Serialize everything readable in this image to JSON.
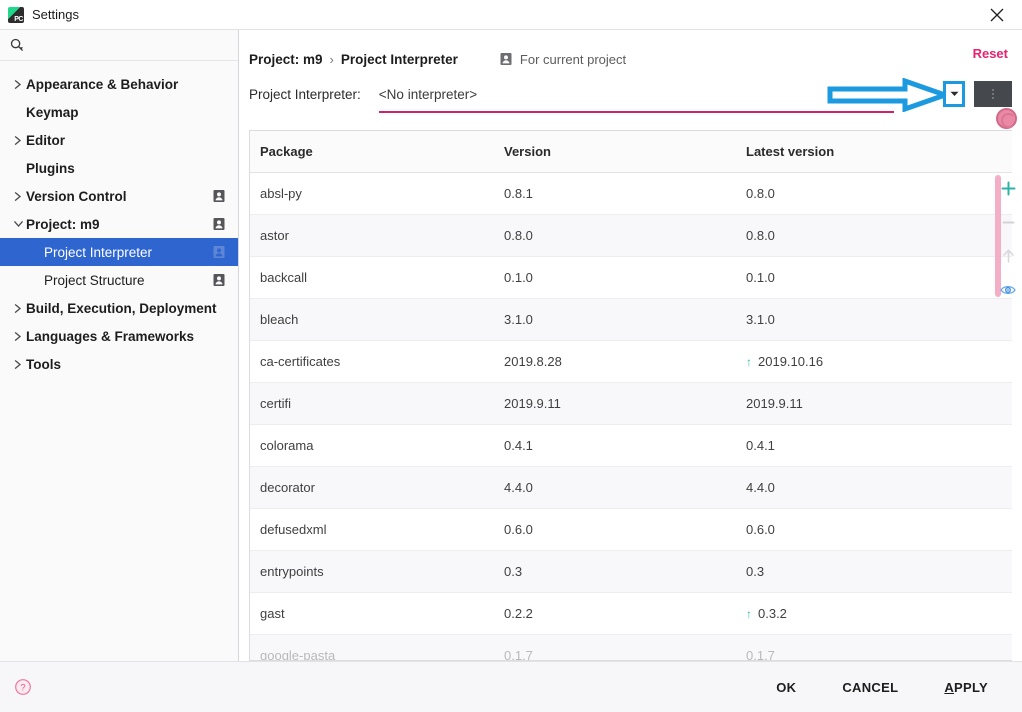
{
  "window": {
    "title": "Settings",
    "logo_icon": "pycharm-logo-icon",
    "close_icon": "close-icon"
  },
  "sidebar": {
    "search": {
      "placeholder": "",
      "value": "",
      "icon": "search-icon"
    },
    "items": [
      {
        "label": "Appearance & Behavior",
        "chevron": "chevron-right",
        "level": 0,
        "bold": true,
        "badge": false,
        "selected": false
      },
      {
        "label": "Keymap",
        "chevron": "",
        "level": 0,
        "bold": true,
        "badge": false,
        "selected": false
      },
      {
        "label": "Editor",
        "chevron": "chevron-right",
        "level": 0,
        "bold": true,
        "badge": false,
        "selected": false
      },
      {
        "label": "Plugins",
        "chevron": "",
        "level": 0,
        "bold": true,
        "badge": false,
        "selected": false
      },
      {
        "label": "Version Control",
        "chevron": "chevron-right",
        "level": 0,
        "bold": true,
        "badge": true,
        "selected": false
      },
      {
        "label": "Project: m9",
        "chevron": "chevron-down",
        "level": 0,
        "bold": true,
        "badge": true,
        "selected": false
      },
      {
        "label": "Project Interpreter",
        "chevron": "",
        "level": 1,
        "bold": false,
        "badge": true,
        "selected": true
      },
      {
        "label": "Project Structure",
        "chevron": "",
        "level": 1,
        "bold": false,
        "badge": true,
        "selected": false
      },
      {
        "label": "Build, Execution, Deployment",
        "chevron": "chevron-right",
        "level": 0,
        "bold": true,
        "badge": false,
        "selected": false
      },
      {
        "label": "Languages & Frameworks",
        "chevron": "chevron-right",
        "level": 0,
        "bold": true,
        "badge": false,
        "selected": false
      },
      {
        "label": "Tools",
        "chevron": "chevron-right",
        "level": 0,
        "bold": true,
        "badge": false,
        "selected": false
      }
    ]
  },
  "header": {
    "breadcrumb_parent": "Project: m9",
    "breadcrumb_separator": "›",
    "breadcrumb_current": "Project Interpreter",
    "scope_label": "For current project",
    "scope_icon": "project-badge-icon",
    "reset_label": "Reset"
  },
  "interpreter": {
    "label": "Project Interpreter:",
    "value": "<No interpreter>",
    "dropdown_icon": "chevron-down-icon",
    "more_icon": "more-vertical-icon",
    "annotation_icon": "blue-arrow-annotation",
    "underline_color": "#d0216b",
    "highlight_color": "#1b9ae0"
  },
  "packages": {
    "columns": [
      "Package",
      "Version",
      "Latest version"
    ],
    "rows": [
      {
        "package": "absl-py",
        "version": "0.8.1",
        "latest": "0.8.0",
        "upgradable": false
      },
      {
        "package": "astor",
        "version": "0.8.0",
        "latest": "0.8.0",
        "upgradable": false
      },
      {
        "package": "backcall",
        "version": "0.1.0",
        "latest": "0.1.0",
        "upgradable": false
      },
      {
        "package": "bleach",
        "version": "3.1.0",
        "latest": "3.1.0",
        "upgradable": false
      },
      {
        "package": "ca-certificates",
        "version": "2019.8.28",
        "latest": "2019.10.16",
        "upgradable": true
      },
      {
        "package": "certifi",
        "version": "2019.9.11",
        "latest": "2019.9.11",
        "upgradable": false
      },
      {
        "package": "colorama",
        "version": "0.4.1",
        "latest": "0.4.1",
        "upgradable": false
      },
      {
        "package": "decorator",
        "version": "4.4.0",
        "latest": "4.4.0",
        "upgradable": false
      },
      {
        "package": "defusedxml",
        "version": "0.6.0",
        "latest": "0.6.0",
        "upgradable": false
      },
      {
        "package": "entrypoints",
        "version": "0.3",
        "latest": "0.3",
        "upgradable": false
      },
      {
        "package": "gast",
        "version": "0.2.2",
        "latest": "0.3.2",
        "upgradable": true
      },
      {
        "package": "google-pasta",
        "version": "0.1.7",
        "latest": "0.1.7",
        "upgradable": false
      }
    ],
    "upgrade_arrow_glyph": "↑",
    "upgrade_arrow_color": "#3fb8a8",
    "scrollbar_color": "#f4aec5"
  },
  "rail": {
    "buttons": [
      {
        "icon": "plus-icon",
        "label": "Install",
        "enabled": true
      },
      {
        "icon": "minus-icon",
        "label": "Uninstall",
        "enabled": false
      },
      {
        "icon": "arrow-up-icon",
        "label": "Upgrade",
        "enabled": false
      },
      {
        "icon": "eye-icon",
        "label": "Show early releases",
        "enabled": true
      }
    ],
    "cursor_marker": "mouse-cursor-highlight"
  },
  "footer": {
    "help_icon": "help-circle-icon",
    "ok_label": "OK",
    "cancel_label": "CANCEL",
    "apply_label_prefix": "A",
    "apply_label_rest": "PPLY"
  }
}
